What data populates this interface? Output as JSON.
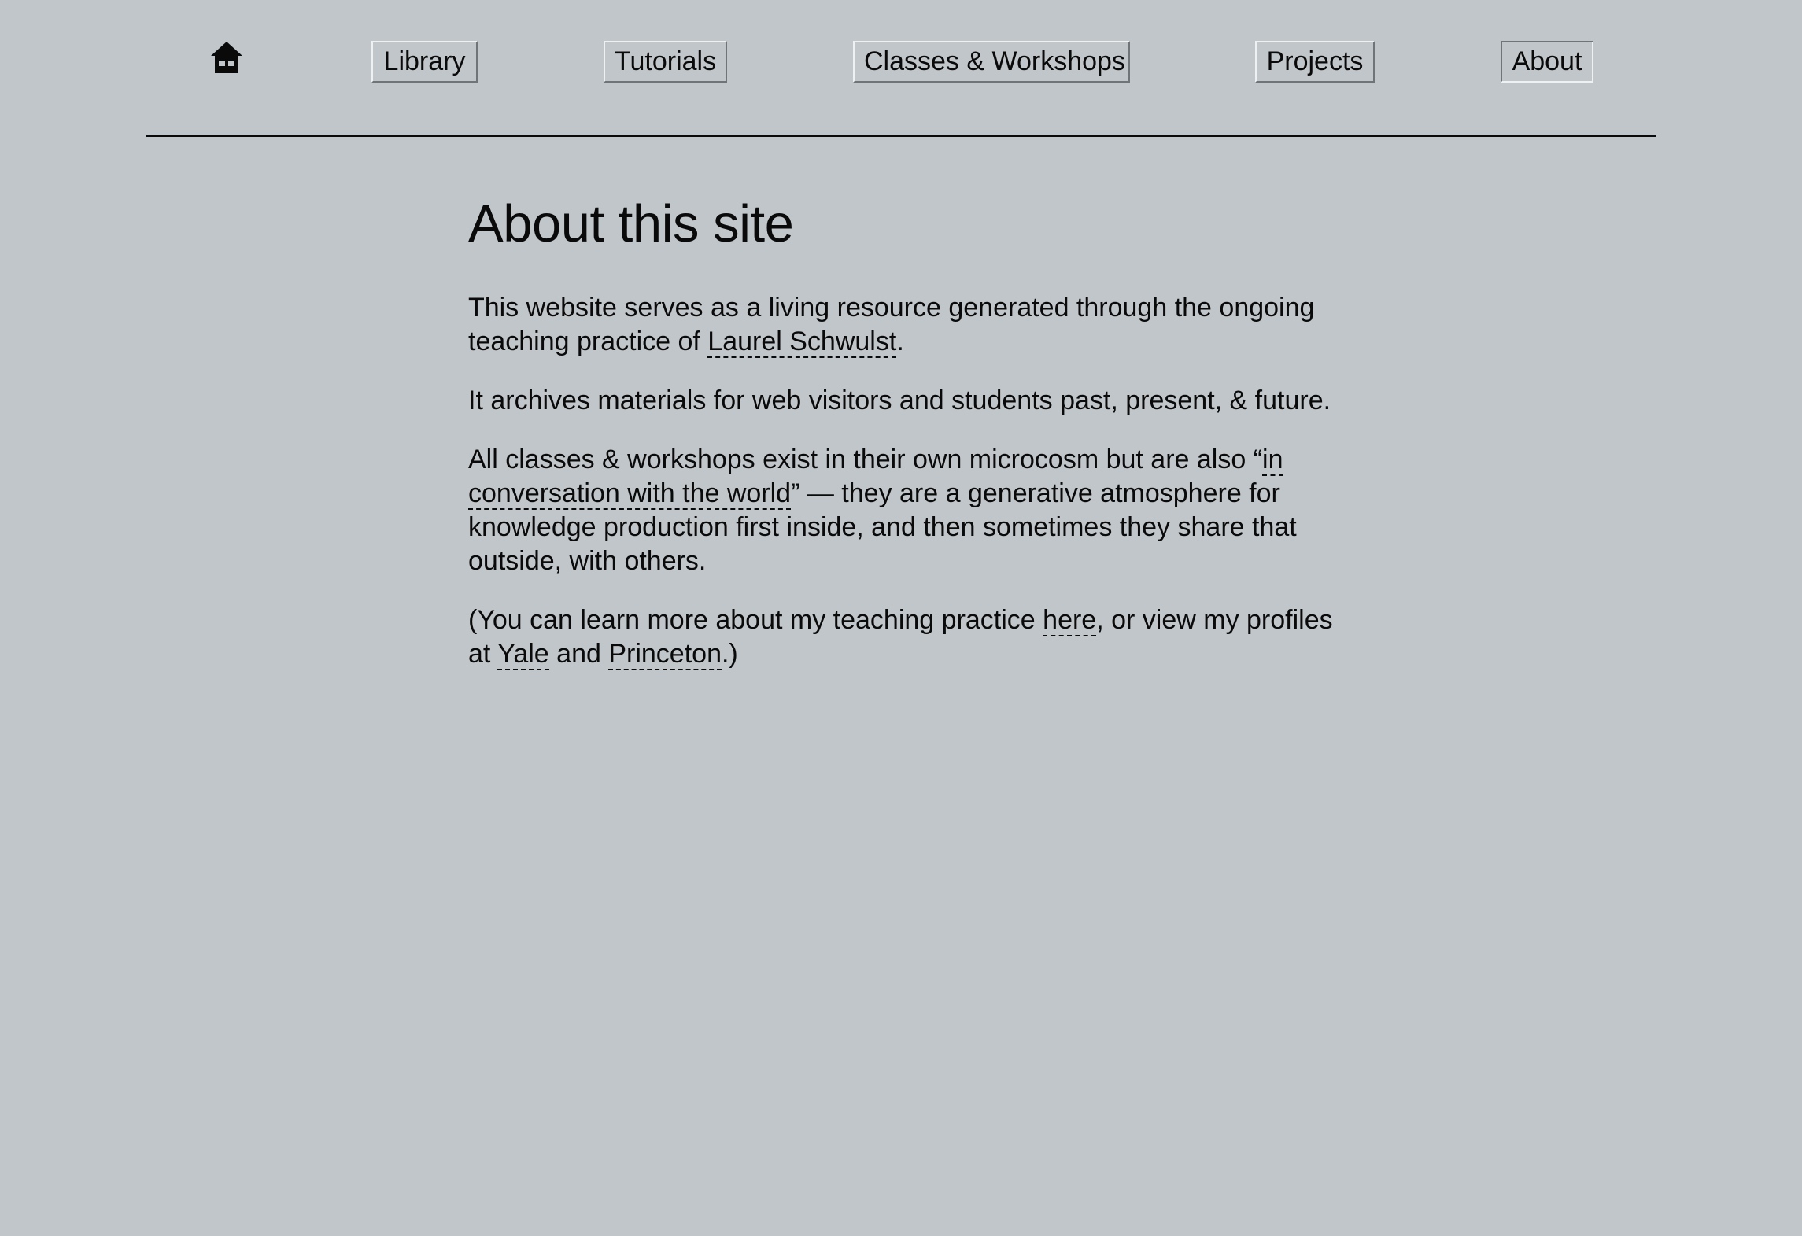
{
  "nav": {
    "home_icon": "home-icon",
    "items": [
      {
        "label": "Library"
      },
      {
        "label": "Tutorials"
      },
      {
        "label": "Classes & Workshops"
      },
      {
        "label": "Projects"
      },
      {
        "label": "About",
        "active": true
      }
    ]
  },
  "main": {
    "title": "About this site",
    "p1": {
      "before": "This website serves as a living resource generated through the ongoing teaching practice of ",
      "link": "Laurel Schwulst",
      "after": "."
    },
    "p2": {
      "text": "It archives materials for web visitors and students past, present, & future."
    },
    "p3": {
      "before": "All classes & workshops exist in their own microcosm but are also “",
      "link": "in conversation with the world",
      "after": "” — they are a generative atmosphere for knowledge production first inside, and then sometimes they share that outside, with others."
    },
    "p4": {
      "before": "(You can learn more about my teaching practice ",
      "link_here": "here",
      "middle": ", or view my profiles at ",
      "link_yale": "Yale",
      "and": " and ",
      "link_princeton": "Princeton",
      "after": ".)"
    }
  },
  "colors": {
    "background": "#c1c6ca",
    "text": "#0a0a0a"
  }
}
